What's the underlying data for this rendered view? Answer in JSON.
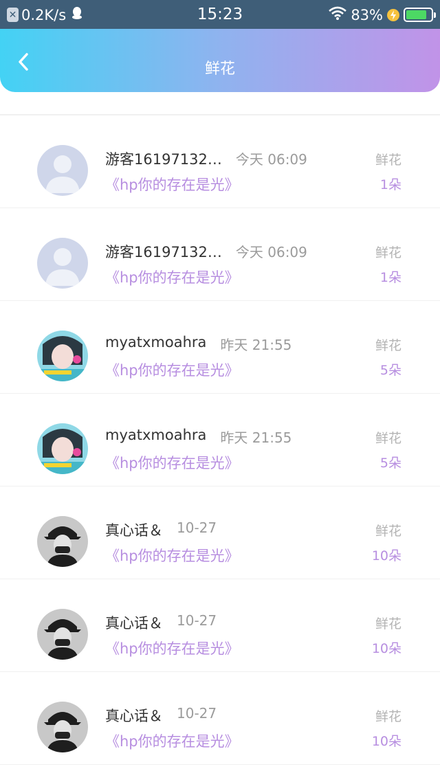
{
  "status_bar": {
    "network_speed": "0.2K/s",
    "time": "15:23",
    "battery_percent": "83%",
    "battery_level": 0.83
  },
  "header": {
    "title": "鲜花",
    "back_icon": "chevron-left-icon"
  },
  "colors": {
    "header_gradient": [
      "#43d2f4",
      "#8fb3ef",
      "#c193e8"
    ],
    "accent": "#b78ee0",
    "muted": "#9b9b9b"
  },
  "records": [
    {
      "user": "游客16197132…",
      "time": "今天 06:09",
      "book": "《hp你的存在是光》",
      "gift": "鲜花",
      "count": "1朵",
      "avatar": "default"
    },
    {
      "user": "游客16197132…",
      "time": "今天 06:09",
      "book": "《hp你的存在是光》",
      "gift": "鲜花",
      "count": "1朵",
      "avatar": "default"
    },
    {
      "user": "myatxmoahra",
      "time": "昨天 21:55",
      "book": "《hp你的存在是光》",
      "gift": "鲜花",
      "count": "5朵",
      "avatar": "photo-girl"
    },
    {
      "user": "myatxmoahra",
      "time": "昨天 21:55",
      "book": "《hp你的存在是光》",
      "gift": "鲜花",
      "count": "5朵",
      "avatar": "photo-girl"
    },
    {
      "user": "真心话＆",
      "time": "10-27",
      "book": "《hp你的存在是光》",
      "gift": "鲜花",
      "count": "10朵",
      "avatar": "photo-bw"
    },
    {
      "user": "真心话＆",
      "time": "10-27",
      "book": "《hp你的存在是光》",
      "gift": "鲜花",
      "count": "10朵",
      "avatar": "photo-bw"
    },
    {
      "user": "真心话＆",
      "time": "10-27",
      "book": "《hp你的存在是光》",
      "gift": "鲜花",
      "count": "10朵",
      "avatar": "photo-bw"
    }
  ]
}
